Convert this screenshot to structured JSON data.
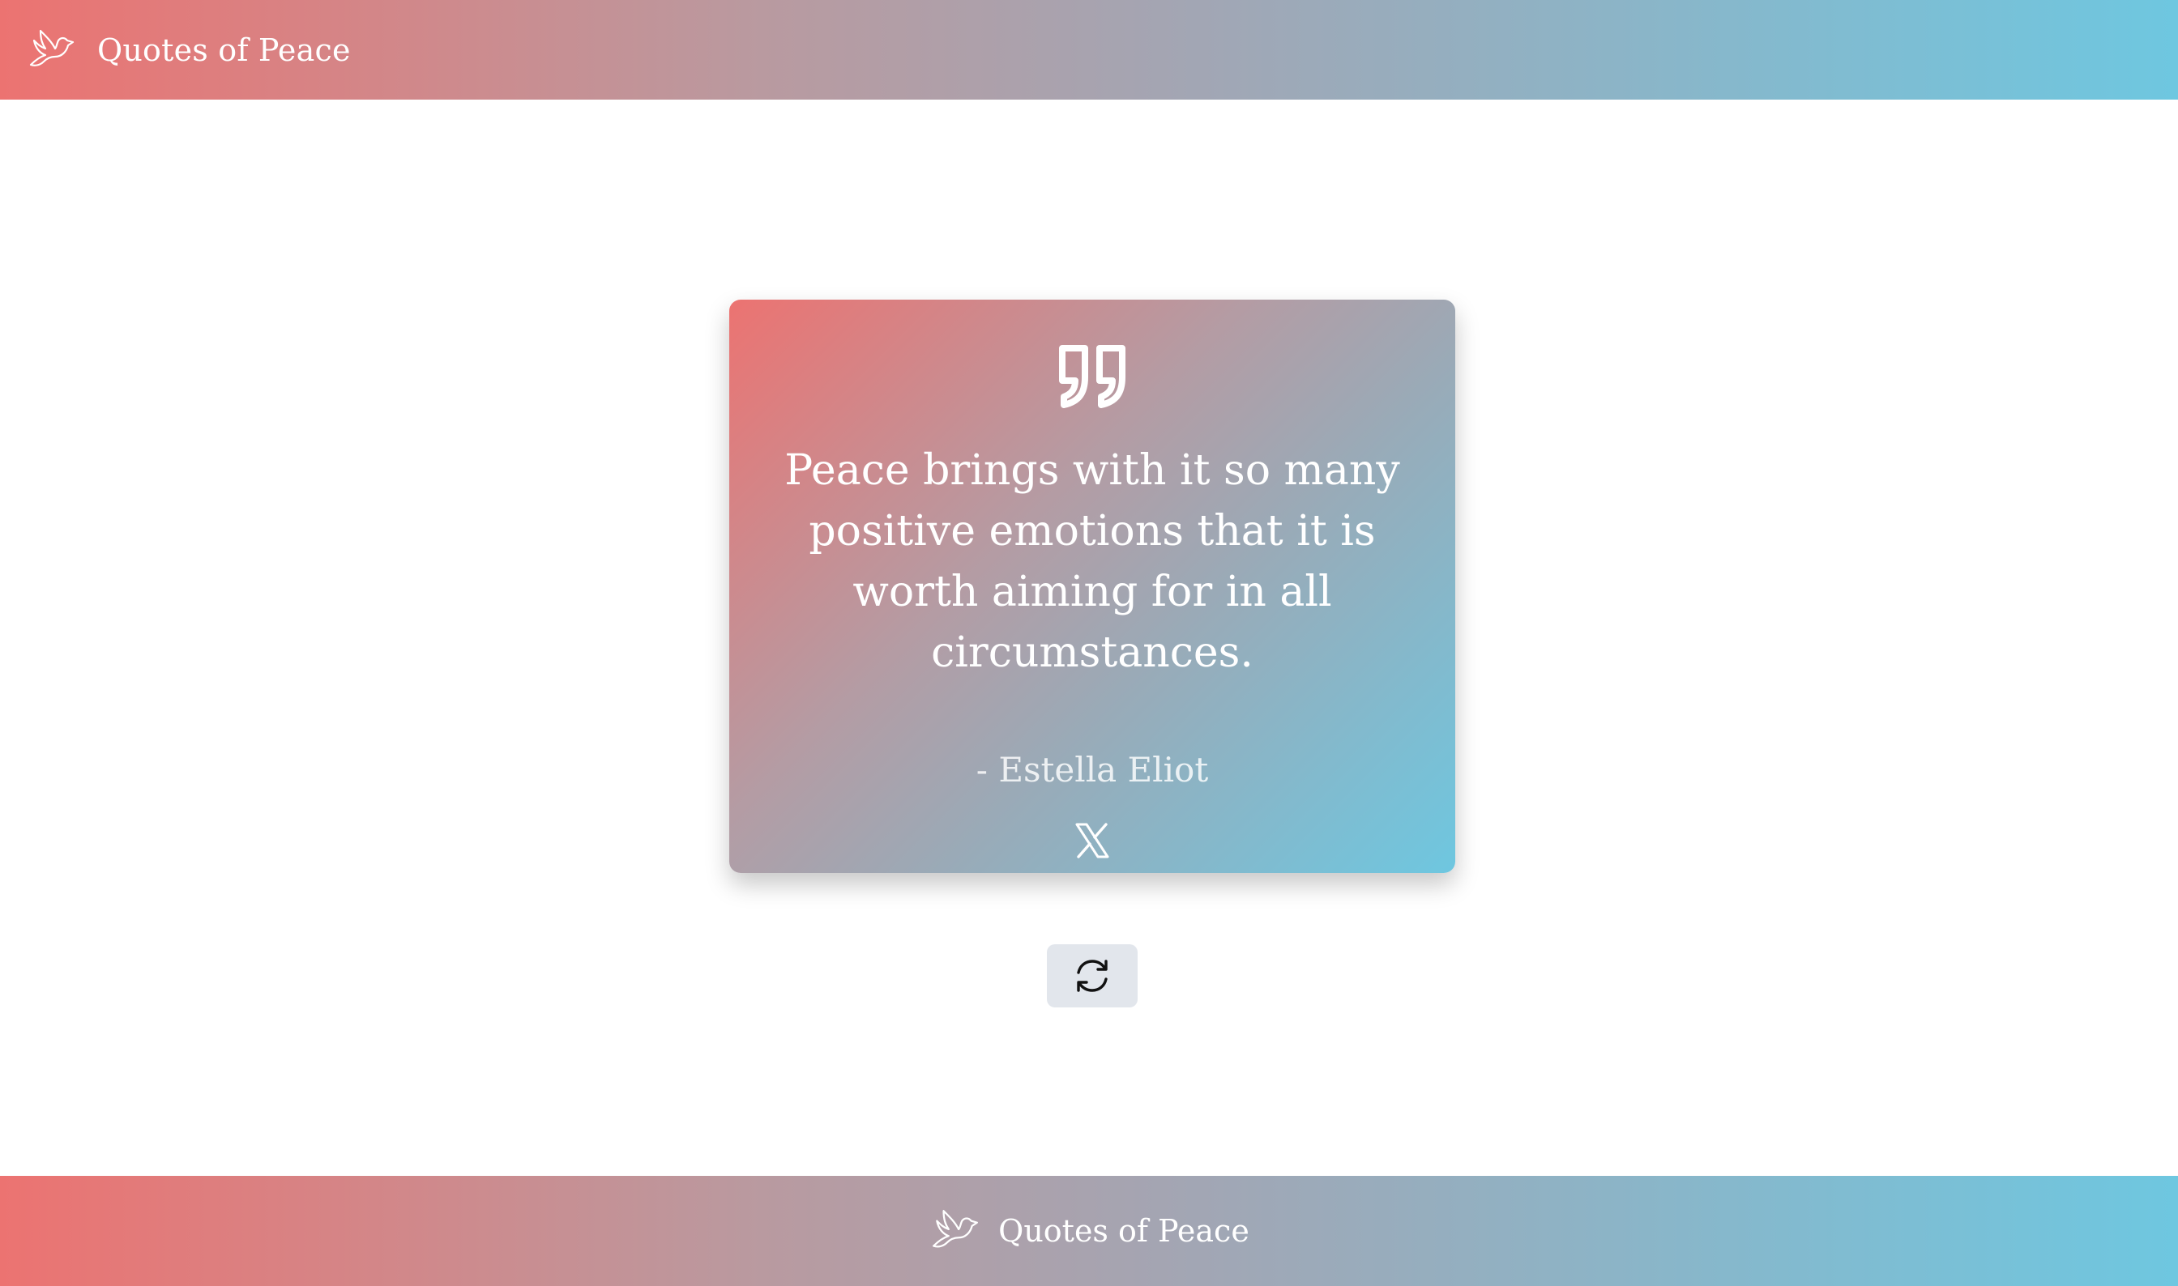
{
  "header": {
    "logo_icon": "dove-icon",
    "title": "Quotes of Peace"
  },
  "quote_card": {
    "quote_icon": "quote-mark-icon",
    "text": "Peace brings with it so many positive emotions that it is worth aiming for in all circumstances.",
    "author": "- Estella Eliot",
    "share_icon": "x-logo-icon"
  },
  "refresh_button": {
    "icon": "refresh-icon"
  },
  "footer": {
    "logo_icon": "dove-icon",
    "title": "Quotes of Peace"
  },
  "colors": {
    "gradient_start": "#ec7371",
    "gradient_end": "#6ec7e0",
    "button_bg": "#e2e6ec"
  }
}
